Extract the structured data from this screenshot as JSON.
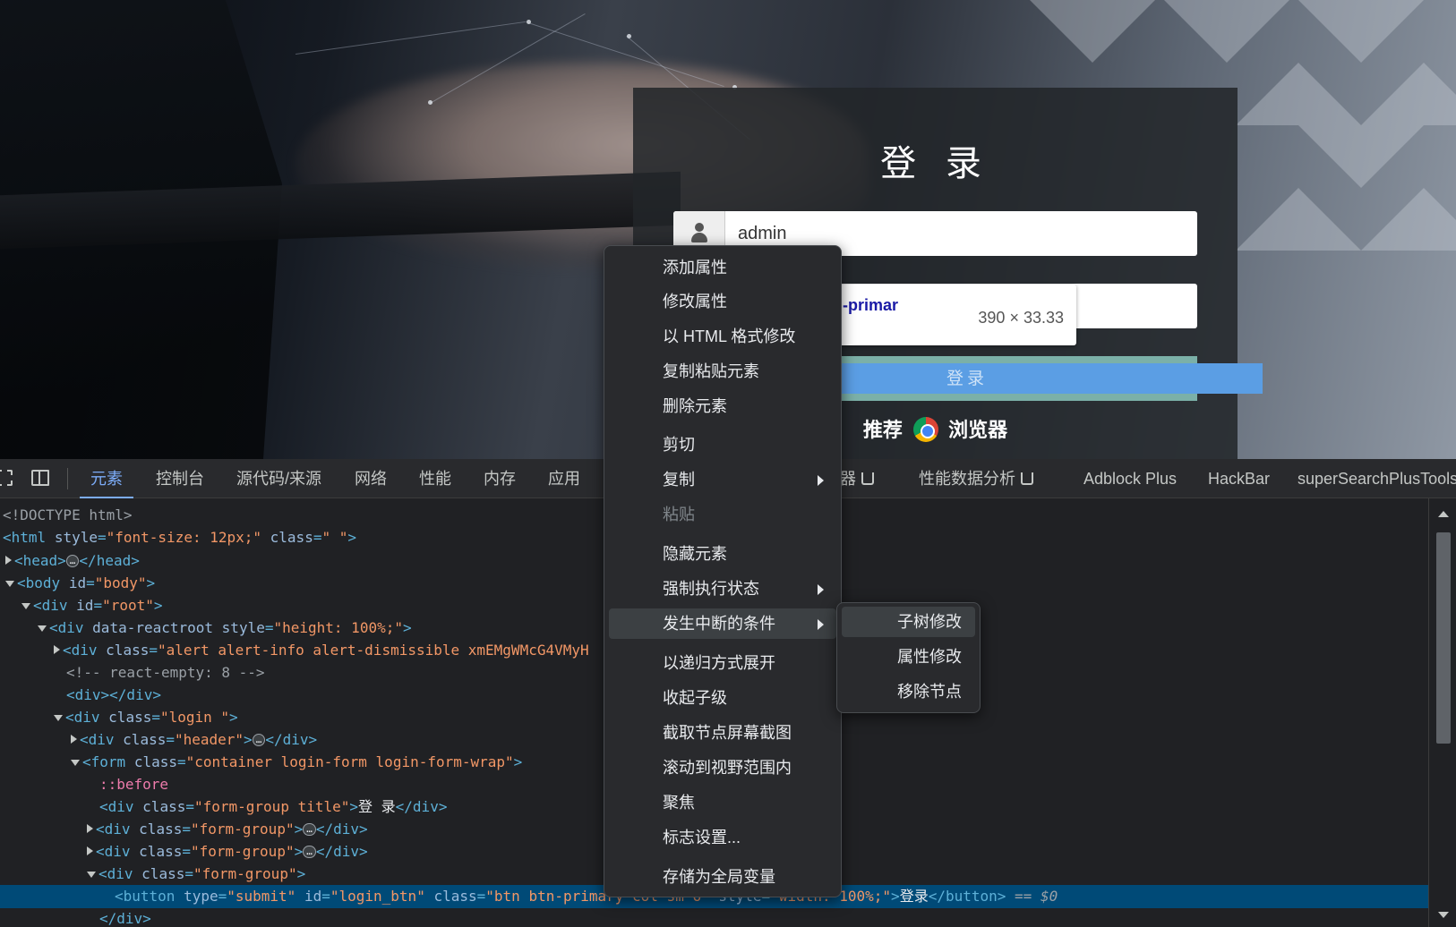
{
  "page": {
    "login_title": "登 录",
    "username_value": "admin",
    "login_button_label": "登录",
    "recommend_prefix": "推荐",
    "recommend_suffix": "浏览器",
    "tooltip": {
      "selector": "btn.btn-primar",
      "size": "390 × 33.33"
    }
  },
  "devtools": {
    "tabs": [
      "元素",
      "控制台",
      "源代码/来源",
      "网络",
      "性能",
      "内存",
      "应用"
    ],
    "right_tabs": {
      "partial_tab": "器",
      "profiler": "性能数据分析",
      "adblock": "Adblock Plus",
      "hackbar": "HackBar",
      "supersearch": "superSearchPlusTools"
    },
    "dom": {
      "doctype": "<!DOCTYPE html>",
      "html_open": {
        "tag": "<html",
        "a1": "style",
        "v1": "\"font-size: 12px;\"",
        "a2": "class",
        "v2": "\" \"",
        "close": ">"
      },
      "head": {
        "open": "<head>",
        "close": "</head>"
      },
      "body": {
        "tag": "<body",
        "a1": "id",
        "v1": "\"body\"",
        "close": ">"
      },
      "root": {
        "tag": "<div",
        "a1": "id",
        "v1": "\"root\"",
        "close": ">"
      },
      "reactroot": {
        "tag": "<div",
        "a1": "data-reactroot",
        "a2": "style",
        "v2": "\"height: 100%;\"",
        "close": ">"
      },
      "alert": {
        "tag": "<div",
        "a1": "class",
        "v1": "\"alert alert-info alert-dismissible xmEMgWMcG4VMyH"
      },
      "comment": "<!-- react-empty: 8 -->",
      "empty_div": "<div></div>",
      "login_div": {
        "tag": "<div",
        "a1": "class",
        "v1": "\"login \"",
        "close": ">"
      },
      "header_div": {
        "tag": "<div",
        "a1": "class",
        "v1": "\"header\"",
        "close": ">",
        "end": "</div>"
      },
      "form": {
        "tag": "<form",
        "a1": "class",
        "v1": "\"container login-form login-form-wrap\"",
        "close": ">"
      },
      "before": "::before",
      "title_div": {
        "tag": "<div",
        "a1": "class",
        "v1": "\"form-group title\"",
        "close": ">",
        "text": "登 录",
        "end": "</div>"
      },
      "fg1": {
        "tag": "<div",
        "a1": "class",
        "v1": "\"form-group\"",
        "close": ">",
        "end": "</div>"
      },
      "fg2": {
        "tag": "<div",
        "a1": "class",
        "v1": "\"form-group\"",
        "close": ">",
        "end": "</div>"
      },
      "fg3": {
        "tag": "<div",
        "a1": "class",
        "v1": "\"form-group\"",
        "close": ">"
      },
      "button": {
        "tag": "<button",
        "a1": "type",
        "v1": "\"submit\"",
        "a2": "id",
        "v2": "\"login_btn\"",
        "a3": "class",
        "v3": "\"btn btn-primary col-sm-6\"",
        "a4": "style",
        "v4": "\"width: 100%;\"",
        "close": ">",
        "text": "登录",
        "end": "</button>",
        "eq": " == ",
        "dollar": "$0"
      },
      "last": "</div>",
      "ellipsis": "…"
    }
  },
  "context_menu": {
    "items": [
      "添加属性",
      "修改属性",
      "以 HTML 格式修改",
      "复制粘贴元素",
      "删除元素",
      "剪切",
      "复制",
      "粘贴",
      "隐藏元素",
      "强制执行状态",
      "发生中断的条件",
      "以递归方式展开",
      "收起子级",
      "截取节点屏幕截图",
      "滚动到视野范围内",
      "聚焦",
      "标志设置...",
      "存储为全局变量"
    ],
    "submenu": [
      "子树修改",
      "属性修改",
      "移除节点"
    ]
  },
  "colors": {
    "devtools_bg": "#202124",
    "selected_row": "#004a77",
    "active_tab": "#7cacf8",
    "tag": "#5db0d7",
    "attr_value": "#f29766"
  }
}
